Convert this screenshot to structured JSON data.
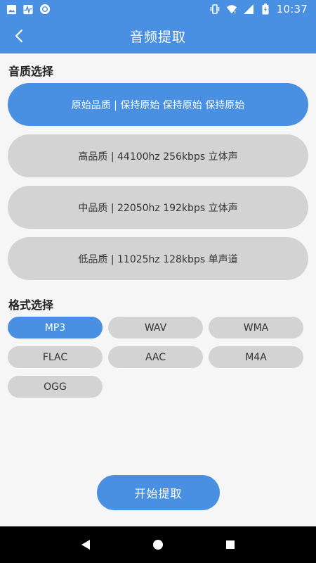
{
  "status_bar": {
    "time": "10:37",
    "left_icons": [
      "image-icon",
      "activity-icon",
      "record-icon"
    ],
    "right_icons": [
      "vibrate-icon",
      "wifi-icon",
      "signal-icon",
      "battery-icon"
    ]
  },
  "app_bar": {
    "title": "音频提取"
  },
  "quality": {
    "title": "音质选择",
    "selected_index": 0,
    "options": [
      {
        "label": "原始品质 | 保持原始 保持原始 保持原始"
      },
      {
        "label": "高品质 | 44100hz 256kbps 立体声"
      },
      {
        "label": "中品质 | 22050hz 192kbps 立体声"
      },
      {
        "label": "低品质 | 11025hz 128kbps 单声道"
      }
    ]
  },
  "format": {
    "title": "格式选择",
    "selected_index": 0,
    "options": [
      {
        "label": "MP3"
      },
      {
        "label": "WAV"
      },
      {
        "label": "WMA"
      },
      {
        "label": "FLAC"
      },
      {
        "label": "AAC"
      },
      {
        "label": "M4A"
      },
      {
        "label": "OGG"
      }
    ]
  },
  "start_button": {
    "label": "开始提取"
  },
  "colors": {
    "accent": "#4a90e2",
    "unselected": "#d3d3d3",
    "background": "#f6f6f6",
    "nav_bar": "#000000"
  }
}
